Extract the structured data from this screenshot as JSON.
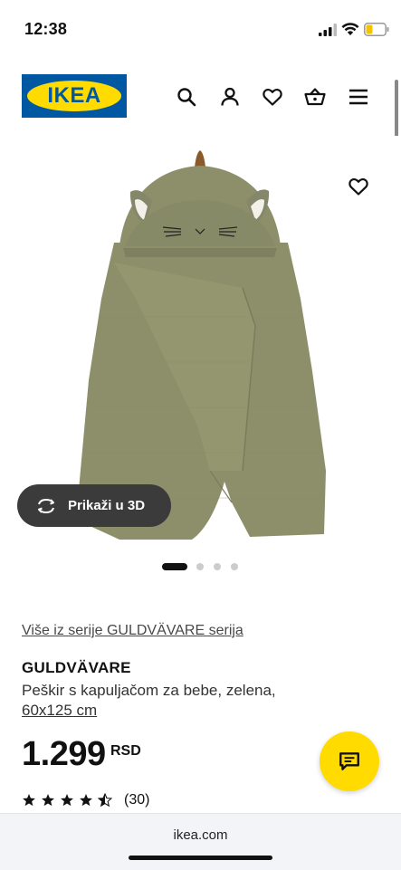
{
  "status_bar": {
    "time": "12:38"
  },
  "header": {
    "logo_text": "IKEA",
    "icons": [
      "search-icon",
      "user-icon",
      "heart-icon",
      "basket-icon",
      "menu-icon"
    ]
  },
  "product_image": {
    "favorite_icon": "heart-icon",
    "view_3d_label": "Prikaži u 3D",
    "carousel_total": 4,
    "carousel_active": 1
  },
  "product": {
    "series_link": "Više iz serije GULDVÄVARE serija",
    "name": "GULDVÄVARE",
    "description": "Peškir s kapuljačom za bebe, zelena,",
    "size": "60x125 cm",
    "price": "1.299",
    "currency": "RSD",
    "rating_stars": 4.5,
    "rating_count": "(30)"
  },
  "chat": {
    "icon": "chat-icon"
  },
  "browser": {
    "url": "ikea.com"
  },
  "colors": {
    "ikea_blue": "#0058a3",
    "ikea_yellow": "#ffdb00",
    "towel_green": "#8c8f6a",
    "button_dark": "#3b3b3b"
  }
}
